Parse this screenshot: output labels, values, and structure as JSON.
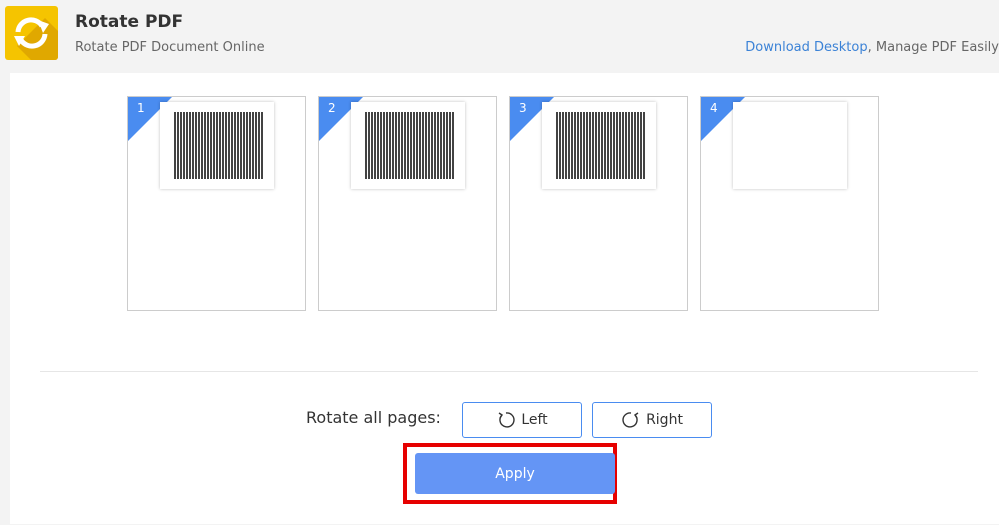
{
  "header": {
    "title": "Rotate PDF",
    "subtitle": "Rotate PDF Document Online",
    "download_link": "Download Desktop",
    "promo_suffix": ", Manage PDF Easily",
    "logo_icon": "rotate-icon"
  },
  "pages": [
    {
      "number": "1",
      "has_text": true
    },
    {
      "number": "2",
      "has_text": true
    },
    {
      "number": "3",
      "has_text": true
    },
    {
      "number": "4",
      "has_text": false
    }
  ],
  "rotate": {
    "label": "Rotate all pages:",
    "left": "Left",
    "right": "Right"
  },
  "apply": "Apply",
  "colors": {
    "accent": "#4a8cf0",
    "apply": "#6495f5",
    "highlight": "#e60000",
    "logo": "#f5c400"
  }
}
